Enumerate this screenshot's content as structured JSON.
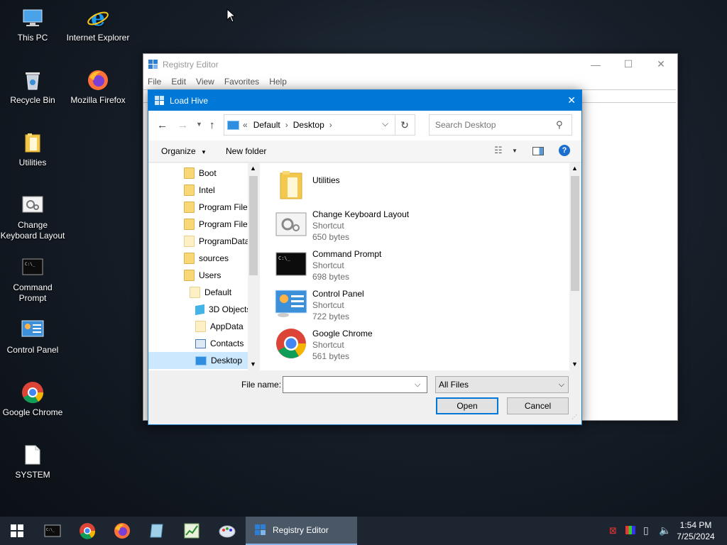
{
  "desktop": {
    "icons": [
      {
        "label": "This PC",
        "icon": "this-pc-icon"
      },
      {
        "label": "Internet Explorer",
        "icon": "internet-explorer-icon"
      },
      {
        "label": "Recycle Bin",
        "icon": "recycle-bin-icon"
      },
      {
        "label": "Mozilla Firefox",
        "icon": "firefox-icon"
      },
      {
        "label": "Utilities",
        "icon": "folder-icon"
      },
      {
        "label": "Change\nKeyboard Layout",
        "icon": "keyboard-layout-icon"
      },
      {
        "label": "Command\nPrompt",
        "icon": "command-prompt-icon"
      },
      {
        "label": "Control Panel",
        "icon": "control-panel-icon"
      },
      {
        "label": "Google Chrome",
        "icon": "chrome-icon"
      },
      {
        "label": "SYSTEM",
        "icon": "file-icon"
      }
    ]
  },
  "registry_window": {
    "title": "Registry Editor",
    "menu": [
      "File",
      "Edit",
      "View",
      "Favorites",
      "Help"
    ],
    "controls": {
      "minimize": "—",
      "maximize": "☐",
      "close": "✕"
    }
  },
  "dialog": {
    "title": "Load Hive",
    "close": "✕",
    "breadcrumb": {
      "prefix": "«",
      "items": [
        "Default",
        "Desktop"
      ]
    },
    "search_placeholder": "Search Desktop",
    "toolbar": {
      "organize": "Organize",
      "new_folder": "New folder"
    },
    "tree": [
      {
        "label": "Boot",
        "indent": 0
      },
      {
        "label": "Intel",
        "indent": 0
      },
      {
        "label": "Program Files",
        "indent": 0
      },
      {
        "label": "Program Files",
        "indent": 0
      },
      {
        "label": "ProgramData",
        "indent": 0
      },
      {
        "label": "sources",
        "indent": 0
      },
      {
        "label": "Users",
        "indent": 0
      },
      {
        "label": "Default",
        "indent": 1
      },
      {
        "label": "3D Objects",
        "indent": 2
      },
      {
        "label": "AppData",
        "indent": 2
      },
      {
        "label": "Contacts",
        "indent": 2
      },
      {
        "label": "Desktop",
        "indent": 2
      }
    ],
    "files": [
      {
        "name": "Utilities",
        "type": "",
        "size": ""
      },
      {
        "name": "Change Keyboard Layout",
        "type": "Shortcut",
        "size": "650 bytes"
      },
      {
        "name": "Command Prompt",
        "type": "Shortcut",
        "size": "698 bytes"
      },
      {
        "name": "Control Panel",
        "type": "Shortcut",
        "size": "722 bytes"
      },
      {
        "name": "Google Chrome",
        "type": "Shortcut",
        "size": "561 bytes"
      }
    ],
    "filename_label": "File name:",
    "filename_value": "",
    "filetype": "All Files",
    "open": "Open",
    "cancel": "Cancel"
  },
  "taskbar": {
    "active_app": "Registry Editor",
    "time": "1:54 PM",
    "date": "7/25/2024"
  }
}
